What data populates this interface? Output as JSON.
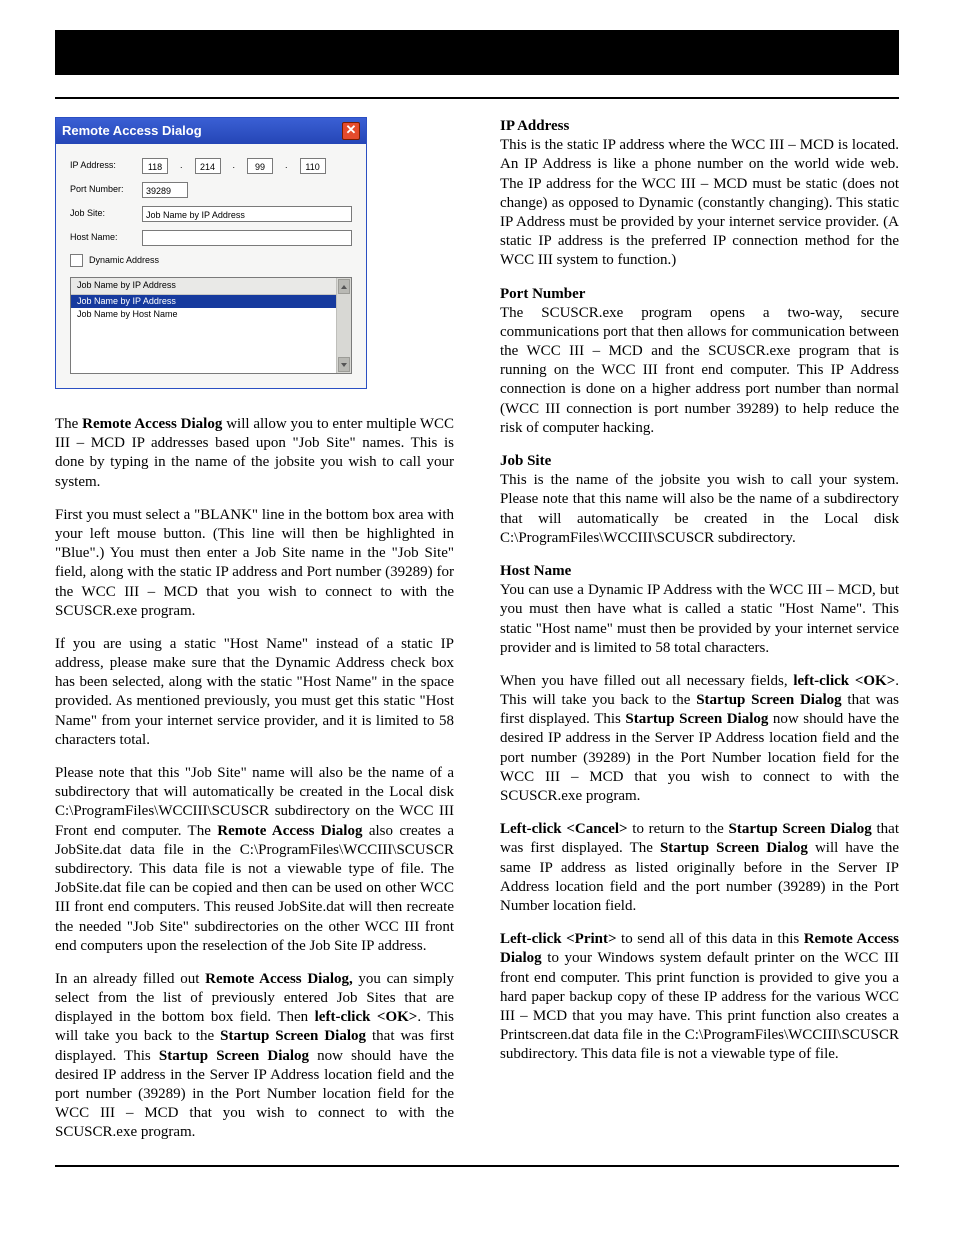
{
  "dialog": {
    "title": "Remote Access Dialog",
    "close_glyph": "✕",
    "labels": {
      "ip": "IP Address:",
      "port": "Port Number:",
      "site": "Job Site:",
      "host": "Host Name:",
      "dyn": "Dynamic Address"
    },
    "values": {
      "ip": [
        "118",
        "214",
        "99",
        "110"
      ],
      "port": "39289",
      "site": "Job Name by IP Address",
      "host": ""
    },
    "listbox": {
      "header": "Job Name by IP Address",
      "items": [
        "Job Name by IP Address",
        "Job Name by Host Name"
      ],
      "selected_index": 0
    }
  },
  "left": {
    "p1a": "The ",
    "p1b": "Remote Access Dialog",
    "p1c": " will allow you to enter multiple WCC III – MCD IP addresses based upon \"Job Site\" names. This is done by typing in the name of the jobsite you wish to call your system.",
    "p2": "First you must select a \"BLANK\" line in the bottom box area with your left mouse button. (This line will then be highlighted in \"Blue\".) You must then enter a Job Site name in the \"Job Site\" field, along with the static IP address and Port number (39289) for the WCC III – MCD that you wish to connect to with the SCUSCR.exe program.",
    "p3": "If you are using a static \"Host Name\" instead of a static IP address, please make sure that the Dynamic Address check box has been selected, along with the static \"Host Name\" in the space provided. As mentioned previously, you must get this static \"Host Name\" from your internet service provider, and it is limited to 58 characters total.",
    "p4a": "Please note that this \"Job Site\" name will also be the name of a subdirectory that will automatically be created in the Local disk C:\\ProgramFiles\\WCCIII\\SCUSCR subdirectory on the WCC III Front end computer. The ",
    "p4b": "Remote Access Dialog",
    "p4c": " also creates a JobSite.dat data file in the C:\\ProgramFiles\\WCCIII\\SCUSCR subdirectory. This data file is not a viewable type of file. The JobSite.dat file can be copied and then can be used on other WCC III front end computers. This reused JobSite.dat will then recreate the needed \"Job Site\" subdirectories on the other WCC III front end computers upon the reselection of the Job Site IP address.",
    "p5a": "In an already filled out ",
    "p5b": "Remote Access Dialog,",
    "p5c": " you can simply select from the list of previously entered Job Sites that are displayed in the bottom box field. Then ",
    "p5d": "left-click <OK>",
    "p5e": ". This will take you back to the ",
    "p5f": "Startup Screen Dialog",
    "p5g": " that was first displayed. This ",
    "p5h": "Startup Screen Dialog",
    "p5i": " now should have the desired IP address in the Server IP Address location field and the port number (39289) in the Port Number location field for the WCC III – MCD that you wish to connect to with the SCUSCR.exe program."
  },
  "right": {
    "ip_title": "IP Address",
    "ip_body": "This is the static IP address where the WCC III – MCD is located. An IP Address is like a phone number on the world wide web. The IP address for the WCC III – MCD must be static (does not change) as opposed to Dynamic (constantly changing). This static IP Address must be provided by your internet service provider. (A static IP address is the preferred IP connection method for the WCC III system to function.)",
    "port_title": "Port Number",
    "port_body": "The SCUSCR.exe program opens a two-way, secure communications port that then allows for communication between the WCC III – MCD and the SCUSCR.exe program that is running on the WCC III front end computer. This IP Address connection is done on a higher address port number than normal (WCC III connection is port number 39289) to help reduce the risk of computer hacking.",
    "job_title": "Job Site",
    "job_body": "This is the name of the jobsite you wish to call your system. Please note that this name will also be the name of a subdirectory that will automatically be created in the Local disk C:\\ProgramFiles\\WCCIII\\SCUSCR subdirectory.",
    "host_title": "Host Name",
    "host_body": "You can use a Dynamic IP Address with the WCC III – MCD, but you must then have what is called a static \"Host Name\". This static \"Host name\" must then be provided by your internet service provider and is limited to 58 total characters.",
    "ok1a": "When you have filled out all necessary fields, ",
    "ok1b": "left-click <OK>",
    "ok1c": ". This will take you back to the ",
    "ok1d": "Startup Screen Dialog",
    "ok1e": " that was first displayed. This ",
    "ok1f": "Startup Screen Dialog",
    "ok1g": " now should have the desired IP address in the Server IP Address location field and the port number (39289) in the Port Number location field for the WCC III – MCD that you wish to connect to with the SCUSCR.exe program.",
    "cx1a": "Left-click <Cancel>",
    "cx1b": " to return to the ",
    "cx1c": "Startup Screen Dialog",
    "cx1d": " that was first displayed. The ",
    "cx1e": "Startup Screen Dialog",
    "cx1f": " will have the same IP address as listed originally before in the Server IP Address location field and the port number (39289) in the Port Number location field.",
    "pr1a": "Left-click <Print>",
    "pr1b": " to send all of this data in this ",
    "pr1c": "Remote Access Dialog",
    "pr1d": " to your Windows system default printer on the WCC III front end computer. This print function is provided to give you a hard paper backup copy of these IP address for the various WCC III – MCD that you may have. This print function also creates a Printscreen.dat data file in the C:\\ProgramFiles\\WCCIII\\SCUSCR subdirectory. This data file is not a viewable type of file."
  }
}
